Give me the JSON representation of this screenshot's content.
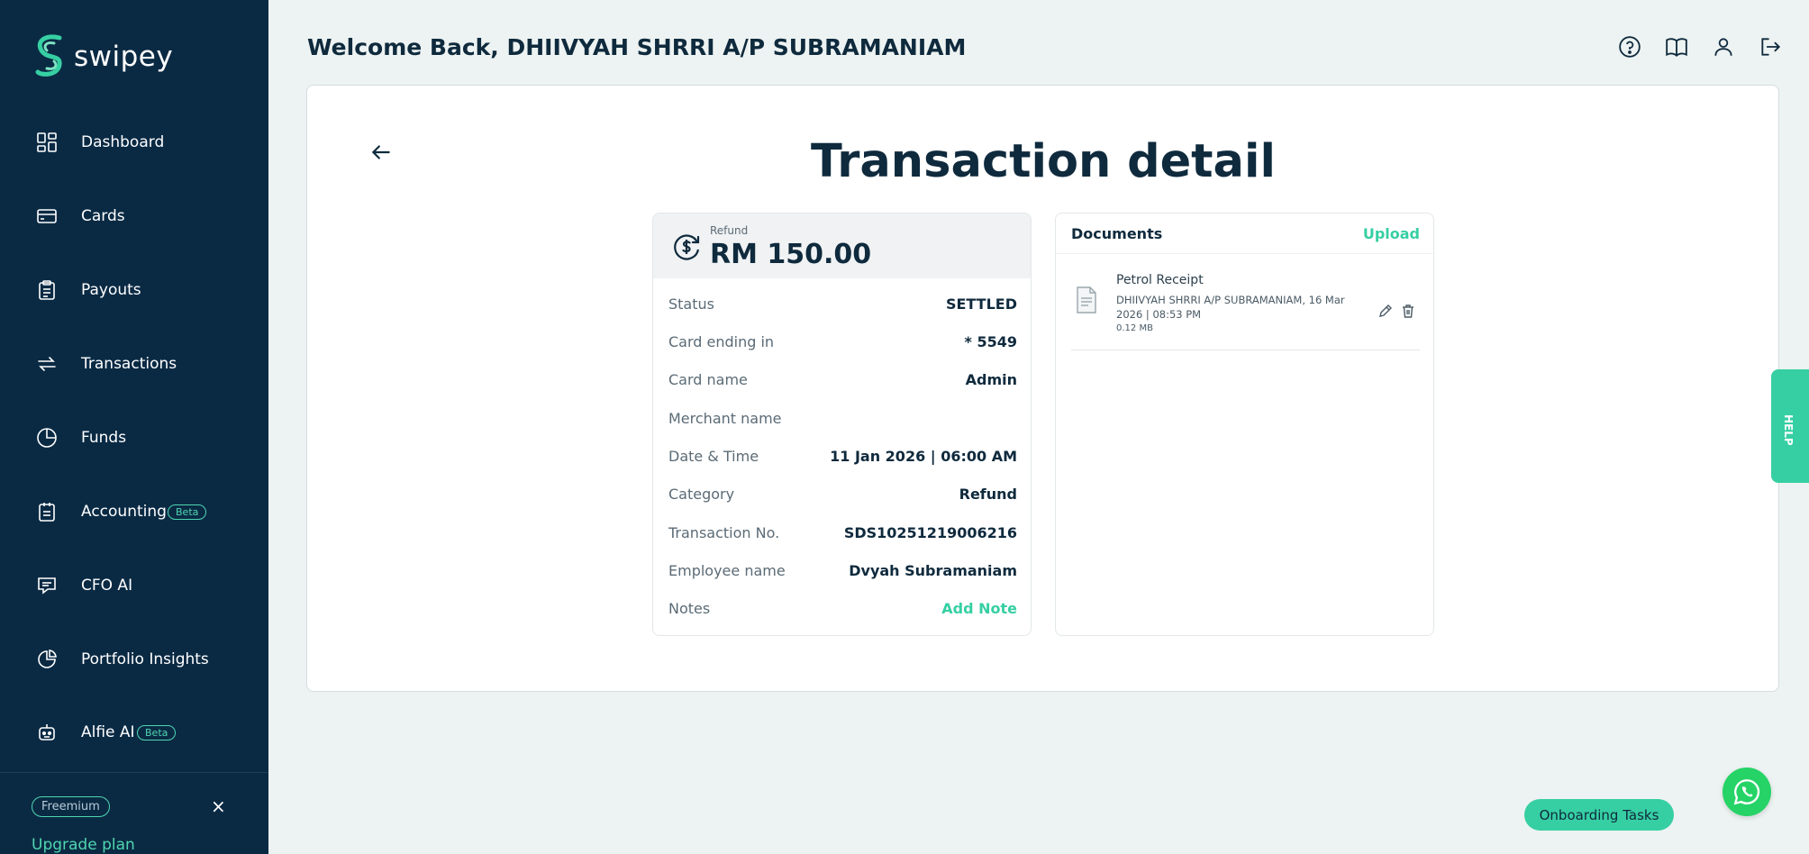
{
  "app": {
    "name": "swipey"
  },
  "colors": {
    "sidebar": "#0a2a44",
    "accent": "#36cfa3",
    "background": "#edf3f2"
  },
  "sidebar": {
    "items": [
      {
        "label": "Dashboard",
        "icon": "dashboard-icon"
      },
      {
        "label": "Cards",
        "icon": "card-icon"
      },
      {
        "label": "Payouts",
        "icon": "clipboard-icon"
      },
      {
        "label": "Transactions",
        "icon": "transfer-icon"
      },
      {
        "label": "Funds",
        "icon": "pie-chart-icon"
      },
      {
        "label": "Accounting",
        "icon": "accounting-icon",
        "badge": "Beta"
      },
      {
        "label": "CFO AI",
        "icon": "chat-icon"
      },
      {
        "label": "Portfolio Insights",
        "icon": "portfolio-icon"
      },
      {
        "label": "Alfie AI",
        "icon": "robot-icon",
        "badge": "Beta"
      }
    ],
    "plan_badge": "Freemium",
    "close_symbol": "×",
    "upgrade_label": "Upgrade plan"
  },
  "header": {
    "welcome": "Welcome Back, DHIIVYAH SHRRI A/P SUBRAMANIAM",
    "icons": [
      "help-icon",
      "book-icon",
      "user-icon",
      "logout-icon"
    ]
  },
  "page": {
    "title": "Transaction detail"
  },
  "transaction": {
    "type_label": "Refund",
    "amount": "RM 150.00",
    "rows": [
      {
        "key": "Status",
        "value": "SETTLED"
      },
      {
        "key": "Card ending in",
        "value": "* 5549"
      },
      {
        "key": "Card name",
        "value": "Admin"
      },
      {
        "key": "Merchant name",
        "value": ""
      },
      {
        "key": "Date & Time",
        "value": "11 Jan 2026 | 06:00 AM"
      },
      {
        "key": "Category",
        "value": "Refund"
      },
      {
        "key": "Transaction No.",
        "value": "SDS10251219006216"
      },
      {
        "key": "Employee name",
        "value": "Dvyah Subramaniam"
      },
      {
        "key": "Notes",
        "value": "Add Note"
      }
    ]
  },
  "documents": {
    "title": "Documents",
    "upload_label": "Upload",
    "items": [
      {
        "name": "Petrol Receipt",
        "meta": "DHIIVYAH SHRRI A/P SUBRAMANIAM, 16 Mar 2026 | 08:53 PM",
        "size": "0.12 MB"
      }
    ]
  },
  "help_tab": {
    "label": "HELP"
  },
  "onboarding": {
    "label": "Onboarding Tasks"
  }
}
